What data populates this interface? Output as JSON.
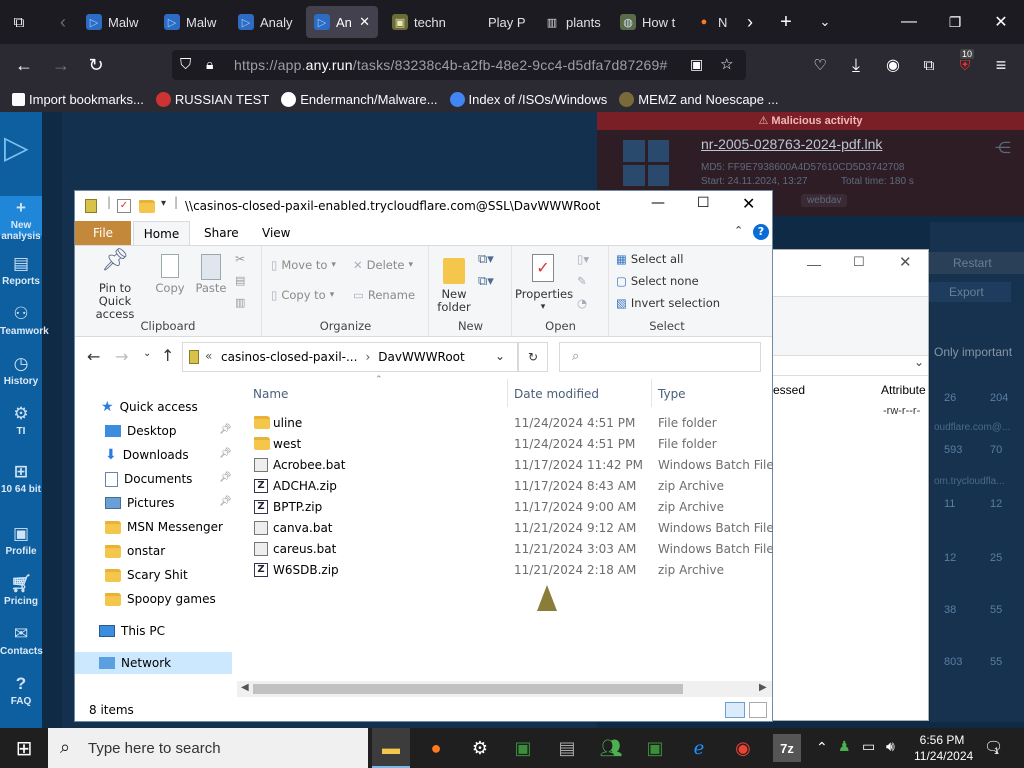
{
  "browser": {
    "tabs": [
      {
        "label": "Malw",
        "icon": "anyrun-icon"
      },
      {
        "label": "Malw",
        "icon": "anyrun-icon"
      },
      {
        "label": "Analy",
        "icon": "anyrun-icon"
      },
      {
        "label": "An",
        "icon": "anyrun-icon",
        "active": true
      },
      {
        "label": "techn",
        "icon": "page-icon"
      },
      {
        "label": "Play P",
        "icon": "play-icon"
      },
      {
        "label": "plants",
        "icon": "columns-icon"
      },
      {
        "label": "How t",
        "icon": "globe-icon"
      },
      {
        "label": "Ne",
        "icon": "firefox-icon"
      }
    ],
    "url_prefix": "https://app.",
    "url_domain": "any.run",
    "url_path": "/tasks/83238c4b-a2fb-48e2-9cc4-d5dfa7d87269#",
    "extensions_badge": "10",
    "bookmarks": [
      {
        "label": "Import bookmarks...",
        "icon": "import-icon"
      },
      {
        "label": "RUSSIAN TEST",
        "icon": "spider-icon"
      },
      {
        "label": "Endermanch/Malware...",
        "icon": "github-icon"
      },
      {
        "label": "Index of /ISOs/Windows",
        "icon": "google-icon"
      },
      {
        "label": "MEMZ and Noescape ...",
        "icon": "image-icon"
      }
    ]
  },
  "anyrun": {
    "sidebar": [
      {
        "label": "New analysis",
        "icon": "plus-icon"
      },
      {
        "label": "Reports",
        "icon": "reports-icon"
      },
      {
        "label": "Teamwork",
        "icon": "teamwork-icon"
      },
      {
        "label": "History",
        "icon": "history-icon"
      },
      {
        "label": "TI",
        "icon": "ti-icon"
      },
      {
        "label": "10 64 bit",
        "icon": "windows-icon"
      },
      {
        "label": "Profile",
        "icon": "profile-icon"
      },
      {
        "label": "Pricing",
        "icon": "cart-icon"
      },
      {
        "label": "Contacts",
        "icon": "mail-icon"
      },
      {
        "label": "FAQ",
        "icon": "help-icon"
      }
    ],
    "verdict": "Malicious activity",
    "task_name": "nr-2005-028763-2024-pdf.lnk",
    "md5": "MD5: FF9E7938600A4D57610CD5D3742708",
    "start": "Start: 24.11.2024, 13:27",
    "total_time": "Total time: 180 s",
    "tag": "webdav",
    "restart": "Restart",
    "export": "Export",
    "only_important": "Only important",
    "bg_col_processed": "essed",
    "bg_col_attributes": "Attribute",
    "bg_attr_value": "-rw-r--r-",
    "bg_rows": [
      {
        "a": "26",
        "b": "204"
      },
      {
        "a": "593",
        "b": "70"
      },
      {
        "a": "11",
        "b": "12"
      },
      {
        "a": "12",
        "b": "25"
      },
      {
        "a": "38",
        "b": "55"
      },
      {
        "a": "803",
        "b": "55"
      }
    ],
    "bg_snippets": [
      "oudflare.com@...",
      "om.trycloudfla..."
    ]
  },
  "explorer": {
    "title": "\\\\casinos-closed-paxil-enabled.trycloudflare.com@SSL\\DavWWWRoot",
    "tabs": {
      "file": "File",
      "home": "Home",
      "share": "Share",
      "view": "View"
    },
    "ribbon": {
      "clipboard": {
        "label": "Clipboard",
        "pin": "Pin to Quick access",
        "copy": "Copy",
        "paste": "Paste"
      },
      "organize": {
        "label": "Organize",
        "move_to": "Move to",
        "copy_to": "Copy to",
        "delete": "Delete",
        "rename": "Rename"
      },
      "new": {
        "label": "New",
        "new_folder": "New folder"
      },
      "open": {
        "label": "Open",
        "properties": "Properties"
      },
      "select": {
        "label": "Select",
        "select_all": "Select all",
        "select_none": "Select none",
        "invert": "Invert selection"
      }
    },
    "breadcrumb": [
      "casinos-closed-paxil-...",
      "DavWWWRoot"
    ],
    "columns": {
      "name": "Name",
      "date": "Date modified",
      "type": "Type"
    },
    "nav": {
      "quick_access": "Quick access",
      "items": [
        {
          "label": "Desktop",
          "icon": "desktop-icon",
          "pinned": true
        },
        {
          "label": "Downloads",
          "icon": "downloads-icon",
          "pinned": true
        },
        {
          "label": "Documents",
          "icon": "documents-icon",
          "pinned": true
        },
        {
          "label": "Pictures",
          "icon": "pictures-icon",
          "pinned": true
        },
        {
          "label": "MSN Messenger",
          "icon": "folder-icon"
        },
        {
          "label": "onstar",
          "icon": "folder-icon"
        },
        {
          "label": "Scary Shit",
          "icon": "folder-icon"
        },
        {
          "label": "Spoopy games",
          "icon": "folder-icon"
        }
      ],
      "this_pc": "This PC",
      "network": "Network"
    },
    "files": [
      {
        "name": "uline",
        "date": "11/24/2024 4:51 PM",
        "type": "File folder",
        "kind": "folder"
      },
      {
        "name": "west",
        "date": "11/24/2024 4:51 PM",
        "type": "File folder",
        "kind": "folder"
      },
      {
        "name": "Acrobee.bat",
        "date": "11/17/2024 11:42 PM",
        "type": "Windows Batch File",
        "kind": "bat"
      },
      {
        "name": "ADCHA.zip",
        "date": "11/17/2024 8:43 AM",
        "type": "zip Archive",
        "kind": "zip"
      },
      {
        "name": "BPTP.zip",
        "date": "11/17/2024 9:00 AM",
        "type": "zip Archive",
        "kind": "zip"
      },
      {
        "name": "canva.bat",
        "date": "11/21/2024 9:12 AM",
        "type": "Windows Batch File",
        "kind": "bat"
      },
      {
        "name": "careus.bat",
        "date": "11/21/2024 3:03 AM",
        "type": "Windows Batch File",
        "kind": "bat"
      },
      {
        "name": "W6SDB.zip",
        "date": "11/21/2024 2:18 AM",
        "type": "zip Archive",
        "kind": "zip"
      }
    ],
    "status": "8 items"
  },
  "taskbar": {
    "search_placeholder": "Type here to search",
    "time": "6:56 PM",
    "date": "11/24/2024",
    "notifications": "1"
  },
  "colors": {
    "browser_bg": "#1c1b22",
    "toolbar_bg": "#2b2a33",
    "anyrun_sidebar": "#0e5fa0",
    "anyrun_bg": "#0f2a45",
    "malicious": "#7a1f25",
    "file_tab": "#c4883a",
    "explorer_accent": "#0078d7"
  }
}
